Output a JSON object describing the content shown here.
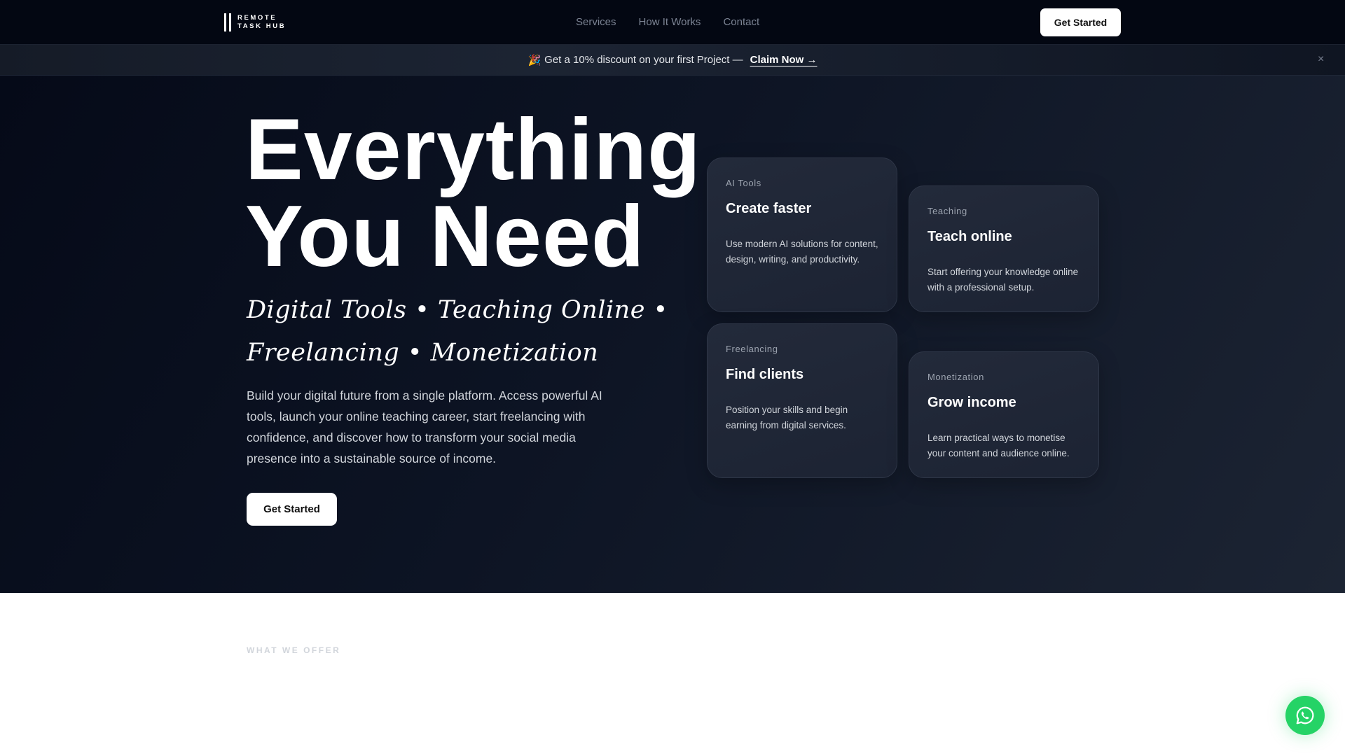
{
  "nav": {
    "logo_line1": "REMOTE",
    "logo_line2": "TASK HUB",
    "links": [
      "Services",
      "How It Works",
      "Contact"
    ],
    "cta": "Get Started"
  },
  "banner": {
    "emoji": "🎉",
    "text": "Get a 10% discount on your first Project —",
    "link": "Claim Now →",
    "close": "×"
  },
  "hero": {
    "title_line1": "Everything",
    "title_line2": "You Need",
    "subtitle": "Digital Tools • Teaching Online • Freelancing • Monetization",
    "paragraph": "Build your digital future from a single platform. Access powerful AI tools, launch your online teaching career, start freelancing with confidence, and discover how to transform your social media presence into a sustainable source of income.",
    "cta": "Get Started"
  },
  "cards": [
    {
      "category": "AI Tools",
      "title": "Create faster",
      "description": "Use modern AI solutions for content, design, writing, and productivity."
    },
    {
      "category": "Teaching",
      "title": "Teach online",
      "description": "Start offering your knowledge online with a professional setup."
    },
    {
      "category": "Freelancing",
      "title": "Find clients",
      "description": "Position your skills and begin earning from digital services."
    },
    {
      "category": "Monetization",
      "title": "Grow income",
      "description": "Learn practical ways to monetise your content and audience online."
    }
  ],
  "offer": {
    "label": "WHAT WE OFFER"
  },
  "colors": {
    "whatsapp": "#25d366",
    "background": "#030712"
  }
}
